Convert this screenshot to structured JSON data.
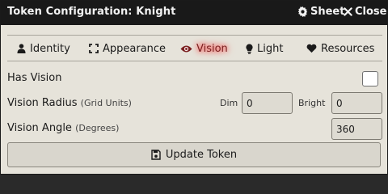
{
  "window": {
    "title": "Token Configuration: Knight",
    "sheet_label": "Sheet",
    "close_label": "Close"
  },
  "tabs": [
    {
      "label": "Identity",
      "icon": "user-icon"
    },
    {
      "label": "Appearance",
      "icon": "expand-icon"
    },
    {
      "label": "Vision",
      "icon": "eye-icon",
      "active": true
    },
    {
      "label": "Light",
      "icon": "lightbulb-icon"
    },
    {
      "label": "Resources",
      "icon": "heart-icon"
    }
  ],
  "vision": {
    "has_vision_label": "Has Vision",
    "has_vision_checked": false,
    "radius_label": "Vision Radius",
    "radius_hint": "(Grid Units)",
    "dim_label": "Dim",
    "dim_value": "0",
    "bright_label": "Bright",
    "bright_value": "0",
    "angle_label": "Vision Angle",
    "angle_hint": "(Degrees)",
    "angle_value": "360"
  },
  "footer": {
    "update_label": "Update Token"
  },
  "colors": {
    "header_bg": "#191919",
    "body_bg": "#e6e3da",
    "active_tab_glow": "#ff2a2a"
  }
}
